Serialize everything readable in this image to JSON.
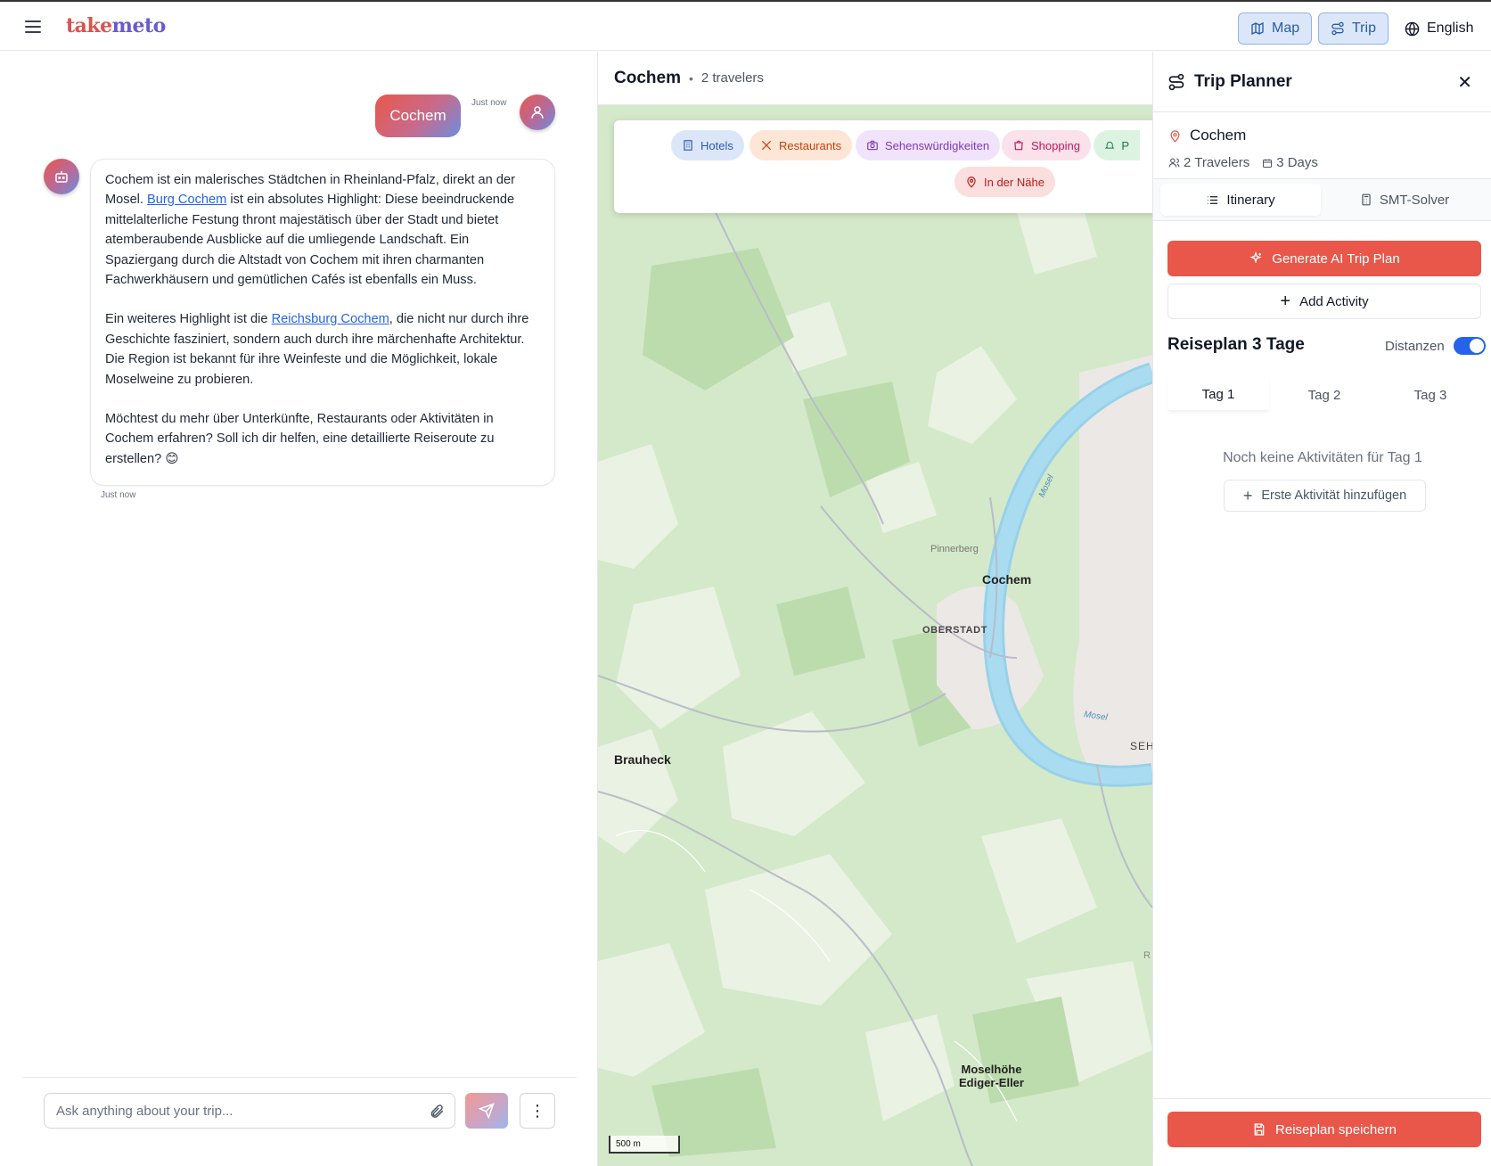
{
  "header": {
    "logo_part1": "take",
    "logo_part2": "meto",
    "map_btn": "Map",
    "trip_btn": "Trip",
    "language": "English"
  },
  "chat": {
    "user_message": "Cochem",
    "user_time": "Just now",
    "bot_time": "Just now",
    "bot_p1_a": "Cochem ist ein malerisches Städtchen in Rheinland-Pfalz, direkt an der Mosel. ",
    "bot_p1_link": "Burg Cochem",
    "bot_p1_b": " ist ein absolutes Highlight: Diese beeindruckende mittelalterliche Festung thront majestätisch über der Stadt und bietet atemberaubende Ausblicke auf die umliegende Landschaft. Ein Spaziergang durch die Altstadt von Cochem mit ihren charmanten Fachwerkhäusern und gemütlichen Cafés ist ebenfalls ein Muss.",
    "bot_p2_a": "Ein weiteres Highlight ist die ",
    "bot_p2_link": "Reichsburg Cochem",
    "bot_p2_b": ", die nicht nur durch ihre Geschichte fasziniert, sondern auch durch ihre märchenhafte Architektur. Die Region ist bekannt für ihre Weinfeste und die Möglichkeit, lokale Moselweine zu probieren.",
    "bot_p3": "Möchtest du mehr über Unterkünfte, Restaurants oder Aktivitäten in Cochem erfahren? Soll ich dir helfen, eine detaillierte Reiseroute zu erstellen? 😊",
    "input_placeholder": "Ask anything about your trip..."
  },
  "map": {
    "title": "Cochem",
    "subtitle": "2 travelers",
    "chips": {
      "hotels": "Hotels",
      "restaurants": "Restaurants",
      "sights": "Sehenswürdigkeiten",
      "shopping": "Shopping",
      "partial": "P",
      "nearby": "In der Nähe"
    },
    "labels": {
      "cochem": "Cochem",
      "oberstadt": "OBERSTADT",
      "pinnerberg": "Pinnerberg",
      "brauheck": "Brauheck",
      "mosel1": "Mosel",
      "mosel2": "Mosel",
      "seh": "SEH",
      "edge_r": "R",
      "moselhoehe1": "Moselhöhe",
      "moselhoehe2": "Ediger-Eller"
    },
    "scale": "500 m",
    "colors": {
      "water": "#9fd8ef",
      "forest": "#cfe6c4",
      "land": "#e8f1e1"
    }
  },
  "planner": {
    "title": "Trip Planner",
    "destination": "Cochem",
    "travelers": "2 Travelers",
    "days": "3 Days",
    "tab_itinerary": "Itinerary",
    "tab_smt": "SMT-Solver",
    "generate_btn": "Generate AI Trip Plan",
    "add_btn": "Add Activity",
    "plan_title": "Reiseplan 3 Tage",
    "distances_label": "Distanzen",
    "day_tabs": [
      "Tag 1",
      "Tag 2",
      "Tag 3"
    ],
    "empty_text": "Noch keine Aktivitäten für Tag 1",
    "first_activity_btn": "Erste Aktivität hinzufügen",
    "save_btn": "Reiseplan speichern",
    "accent": "#e8574a"
  }
}
